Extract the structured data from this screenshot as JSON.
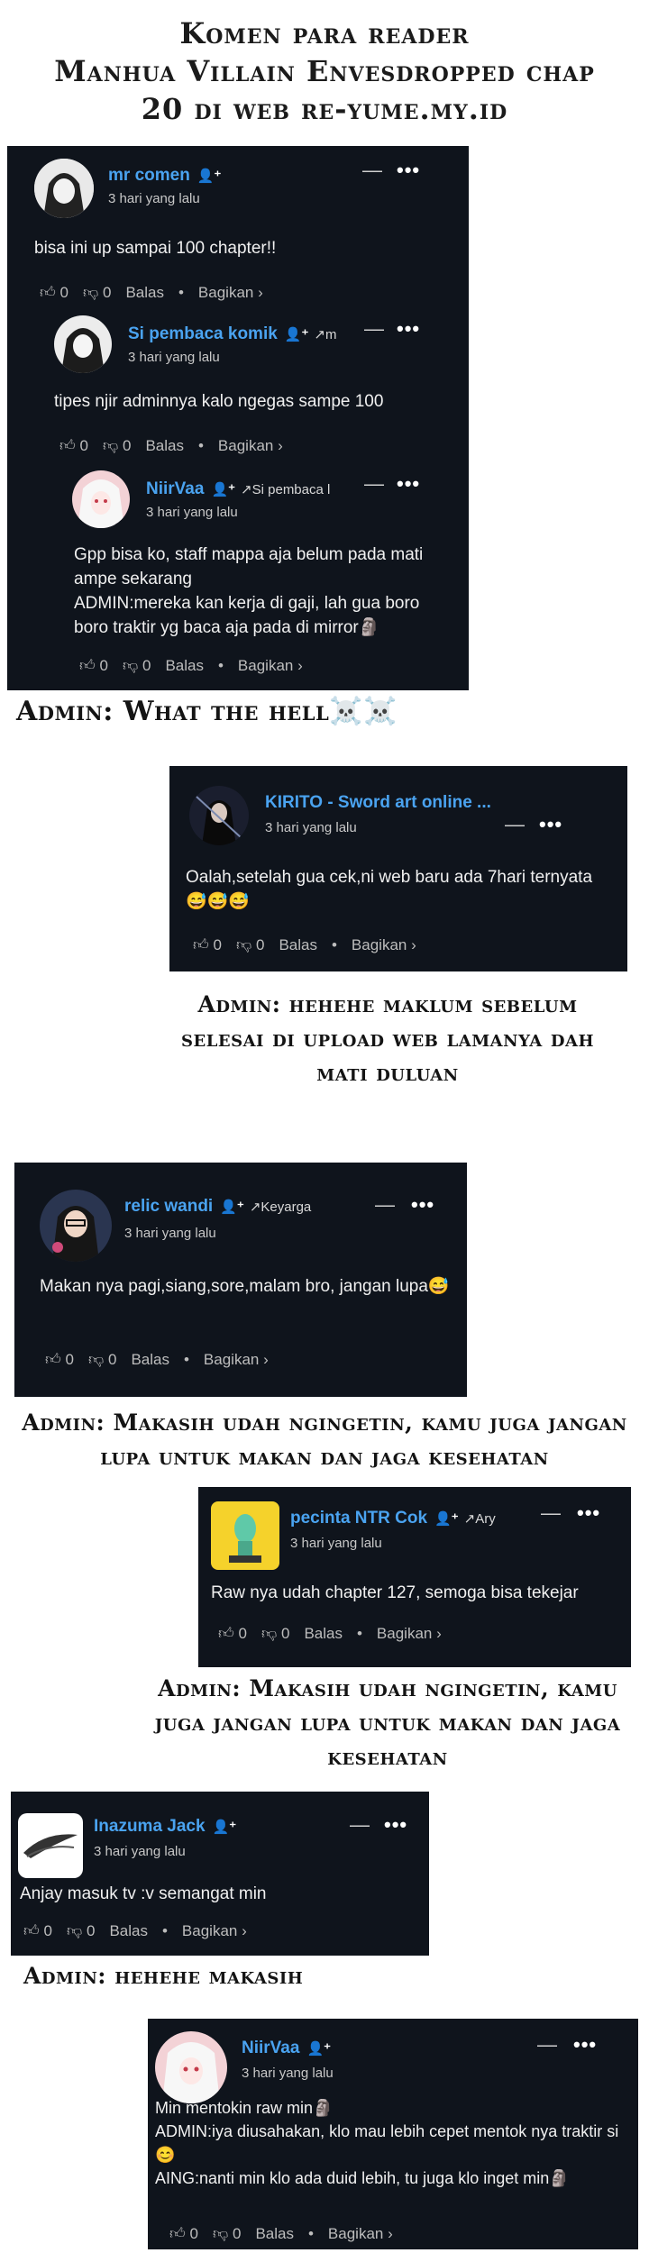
{
  "header": {
    "line1": "Komen para reader",
    "line2": "Manhua Villain Envesdropped chap",
    "line3": "20 di web re-yume.my.id"
  },
  "colors": {
    "card_bg": "#0f141c",
    "username": "#4aa3f0"
  },
  "labels": {
    "balas": "Balas",
    "bagikan": "Bagikan ›",
    "time": "3 hari yang lalu"
  },
  "comments": [
    {
      "user": "mr comen",
      "reply_to": "",
      "likes": "0",
      "dislikes": "0",
      "text": "bisa ini up sampai 100 chapter!!"
    },
    {
      "user": "Si pembaca komik",
      "reply_to": "m",
      "likes": "0",
      "dislikes": "0",
      "text": "tipes njir adminnya kalo ngegas sampe 100"
    },
    {
      "user": "NiirVaa",
      "reply_to": "Si pembaca l",
      "likes": "0",
      "dislikes": "0",
      "text": "Gpp bisa ko, staff mappa aja belum pada mati ampe sekarang\nADMIN:mereka kan kerja di gaji, lah gua boro boro traktir yg baca aja pada di mirror🗿"
    },
    {
      "user": "KIRITO - Sword art online ...",
      "reply_to": "",
      "likes": "0",
      "dislikes": "0",
      "text": "Oalah,setelah gua cek,ni web baru ada 7hari ternyata😅😅😅"
    },
    {
      "user": "relic wandi",
      "reply_to": "Keyarga",
      "likes": "0",
      "dislikes": "0",
      "text": "Makan nya pagi,siang,sore,malam bro, jangan lupa😅"
    },
    {
      "user": "pecinta NTR Cok",
      "reply_to": "Ary",
      "likes": "0",
      "dislikes": "0",
      "text": "Raw nya udah chapter 127, semoga bisa tekejar"
    },
    {
      "user": "Inazuma Jack",
      "reply_to": "",
      "likes": "0",
      "dislikes": "0",
      "text": "Anjay masuk tv :v semangat min"
    },
    {
      "user": "NiirVaa",
      "reply_to": "",
      "likes": "0",
      "dislikes": "0",
      "text": "Min mentokin raw min🗿\nADMIN:iya diusahakan, klo mau lebih cepet mentok nya traktir si😊\nAING:nanti min klo ada duid lebih, tu juga klo inget min🗿"
    }
  ],
  "admin_notes": {
    "what_the_hell": "Admin: What the hell☠️☠️",
    "hehehe_maklum": "Admin: hehehe maklum sebelum selesai di upload web lamanya dah mati duluan",
    "makasih_1": "Admin: Makasih udah ngingetin, kamu juga jangan lupa untuk makan dan jaga kesehatan",
    "makasih_2": "Admin: Makasih udah ngingetin, kamu juga jangan lupa untuk makan dan jaga kesehatan",
    "hehehe_makasih": "Admin: hehehe makasih"
  }
}
